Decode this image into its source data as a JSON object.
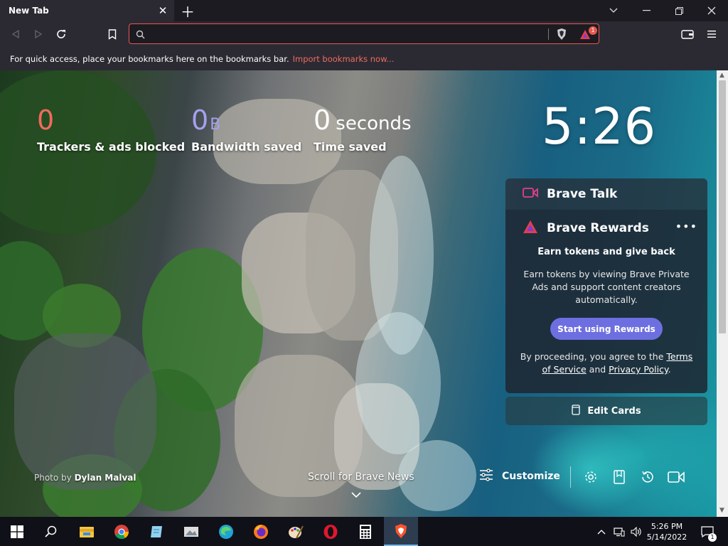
{
  "browser": {
    "tab": {
      "title": "New Tab"
    },
    "url_placeholder": "",
    "rewards_badge": "1",
    "bookmarks_bar": {
      "message": "For quick access, place your bookmarks here on the bookmarks bar.",
      "import_link": "Import bookmarks now..."
    }
  },
  "stats": {
    "trackers": {
      "value": "0",
      "label": "Trackers & ads blocked"
    },
    "bandwidth": {
      "value": "0",
      "unit": "B",
      "label": "Bandwidth saved"
    },
    "time": {
      "value": "0",
      "unit": "seconds",
      "label": "Time saved"
    }
  },
  "clock": "5:26",
  "cards": {
    "talk": {
      "title": "Brave Talk"
    },
    "rewards": {
      "title": "Brave Rewards",
      "more": "•••",
      "subtitle": "Earn tokens and give back",
      "body": "Earn tokens by viewing Brave Private Ads and support content creators automatically.",
      "button": "Start using Rewards",
      "terms_prefix": "By proceeding, you agree to the",
      "terms_link": "Terms of Service",
      "terms_and": "and",
      "privacy_link": "Privacy Policy",
      "terms_suffix": "."
    },
    "edit_cards": "Edit Cards"
  },
  "footer": {
    "photo_prefix": "Photo by",
    "photo_author": "Dylan Malval",
    "scroll_news": "Scroll for Brave News",
    "customize": "Customize"
  },
  "taskbar": {
    "apps": [
      "windows-start",
      "search",
      "file-explorer",
      "chrome",
      "notepad",
      "photos",
      "edge",
      "firefox",
      "paint",
      "opera",
      "calculator",
      "brave"
    ],
    "time": "5:26 PM",
    "date": "5/14/2022",
    "notifications": "1"
  },
  "colors": {
    "accent_red": "#e8584e",
    "tracker_orange": "#f06b5c",
    "bandwidth_purple": "#a6a0f0",
    "rewards_button": "#6d6fe0",
    "talk_icon": "#e33e8b"
  }
}
